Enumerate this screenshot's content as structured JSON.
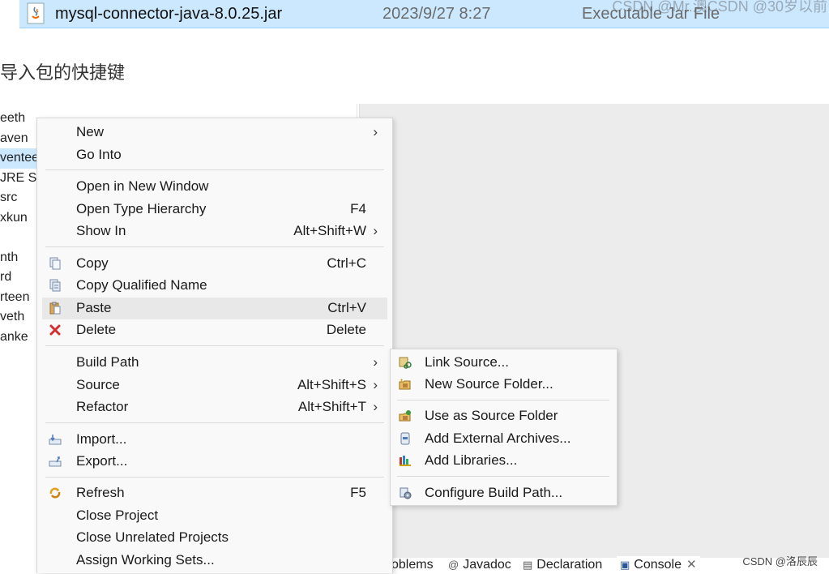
{
  "file_row": {
    "name": "mysql-connector-java-8.0.25.jar",
    "date": "2023/9/27 8:27",
    "type": "Executable Jar File"
  },
  "watermark_top": "CSDN @Mr.澳CSDN @30岁以前",
  "heading": "导入包的快捷键",
  "tree_items": [
    "eeth",
    "aven",
    "venteen",
    "JRE Sy",
    "src",
    "xkun",
    "",
    "nth",
    "rd",
    "rteen",
    "veth",
    "anke"
  ],
  "context_menu": {
    "items": [
      {
        "label": "New",
        "shortcut": "",
        "submenu": true,
        "icon": ""
      },
      {
        "label": "Go Into",
        "shortcut": "",
        "submenu": false,
        "icon": ""
      },
      {
        "label": "Open in New Window",
        "shortcut": "",
        "submenu": false,
        "icon": ""
      },
      {
        "label": "Open Type Hierarchy",
        "shortcut": "F4",
        "submenu": false,
        "icon": ""
      },
      {
        "label": "Show In",
        "shortcut": "Alt+Shift+W",
        "submenu": true,
        "icon": ""
      },
      {
        "label": "Copy",
        "shortcut": "Ctrl+C",
        "submenu": false,
        "icon": "copy-icon"
      },
      {
        "label": "Copy Qualified Name",
        "shortcut": "",
        "submenu": false,
        "icon": "copy-qualified-icon"
      },
      {
        "label": "Paste",
        "shortcut": "Ctrl+V",
        "submenu": false,
        "icon": "paste-icon"
      },
      {
        "label": "Delete",
        "shortcut": "Delete",
        "submenu": false,
        "icon": "delete-icon"
      },
      {
        "label": "Build Path",
        "shortcut": "",
        "submenu": true,
        "icon": ""
      },
      {
        "label": "Source",
        "shortcut": "Alt+Shift+S",
        "submenu": true,
        "icon": ""
      },
      {
        "label": "Refactor",
        "shortcut": "Alt+Shift+T",
        "submenu": true,
        "icon": ""
      },
      {
        "label": "Import...",
        "shortcut": "",
        "submenu": false,
        "icon": "import-icon"
      },
      {
        "label": "Export...",
        "shortcut": "",
        "submenu": false,
        "icon": "export-icon"
      },
      {
        "label": "Refresh",
        "shortcut": "F5",
        "submenu": false,
        "icon": "refresh-icon"
      },
      {
        "label": "Close Project",
        "shortcut": "",
        "submenu": false,
        "icon": ""
      },
      {
        "label": "Close Unrelated Projects",
        "shortcut": "",
        "submenu": false,
        "icon": ""
      },
      {
        "label": "Assign Working Sets...",
        "shortcut": "",
        "submenu": false,
        "icon": ""
      }
    ],
    "highlighted": "Paste"
  },
  "build_path_submenu": {
    "items": [
      {
        "label": "Link Source...",
        "icon": "link-source-icon"
      },
      {
        "label": "New Source Folder...",
        "icon": "new-source-folder-icon"
      },
      {
        "label": "Use as Source Folder",
        "icon": "use-source-folder-icon"
      },
      {
        "label": "Add External Archives...",
        "icon": "add-external-archives-icon"
      },
      {
        "label": "Add Libraries...",
        "icon": "add-libraries-icon"
      },
      {
        "label": "Configure Build Path...",
        "icon": "configure-build-path-icon"
      }
    ]
  },
  "bottom_tabs": [
    {
      "label": "oblems",
      "icon": ""
    },
    {
      "label": "Javadoc",
      "icon": "javadoc-icon"
    },
    {
      "label": "Declaration",
      "icon": "declaration-icon"
    },
    {
      "label": "Console",
      "icon": "console-icon",
      "active": true
    }
  ],
  "watermark_bottom": "CSDN @洛辰辰"
}
